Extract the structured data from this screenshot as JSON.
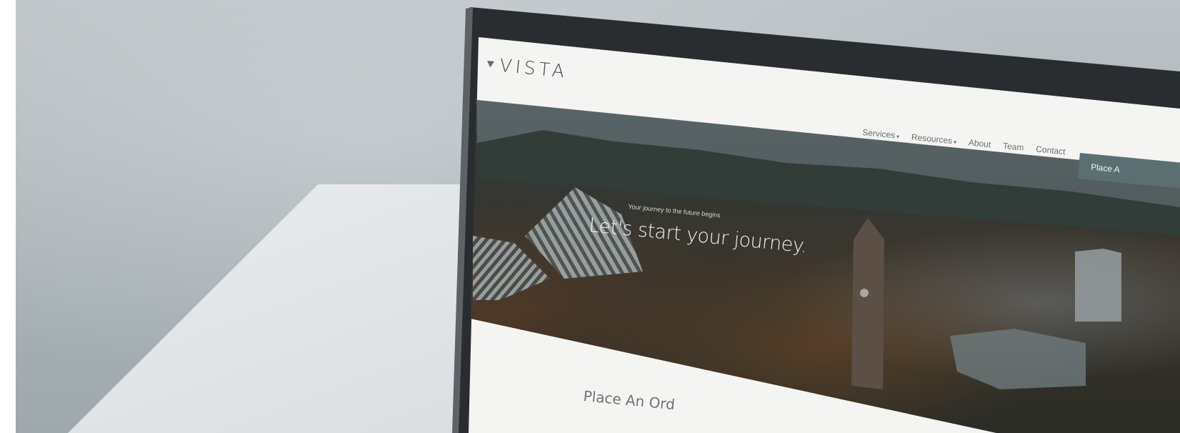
{
  "site": {
    "logo_text": "VISTA"
  },
  "nav": {
    "items": [
      {
        "label": "Services",
        "has_dropdown": true
      },
      {
        "label": "Resources",
        "has_dropdown": true
      },
      {
        "label": "About",
        "has_dropdown": false
      },
      {
        "label": "Team",
        "has_dropdown": false
      },
      {
        "label": "Contact",
        "has_dropdown": false
      }
    ],
    "cta_label": "Place A"
  },
  "hero": {
    "kicker": "Your journey to the future begins",
    "title": "Let's start your journey."
  },
  "section": {
    "title": "Place An Ord"
  },
  "colors": {
    "accent": "#5b6f72",
    "laptop_bezel": "#2a2d30",
    "screen_bg": "#f4f4f2"
  }
}
